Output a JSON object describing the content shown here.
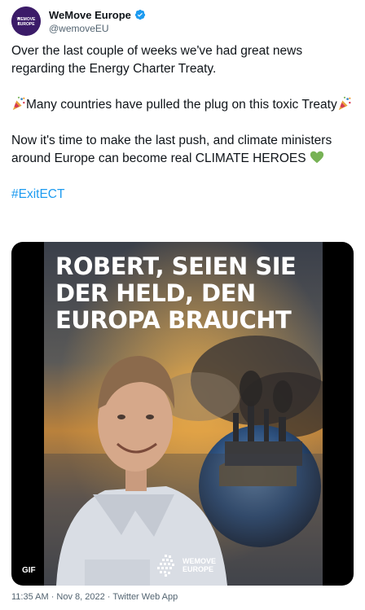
{
  "account": {
    "display_name": "WeMove Europe",
    "handle": "@wemoveEU",
    "avatar_text": "WEMOVE EUROPE"
  },
  "tweet": {
    "para1": "Over the last couple of weeks we've had great news regarding the Energy Charter Treaty.",
    "para2_main": "Many countries have pulled the plug on this toxic Treaty",
    "para3": "Now it's time to make the last push, and climate ministers around Europe can become real CLIMATE HEROES",
    "hashtag": "#ExitECT"
  },
  "media": {
    "headline_lines": [
      "ROBERT, SEIEN SIE",
      "DER HELD, DEN",
      "EUROPA BRAUCHT"
    ],
    "gif_badge": "GIF",
    "brand_line1": "WEMOVE",
    "brand_line2": "EUROPE"
  },
  "meta": {
    "timestamp": "11:35 AM · Nov 8, 2022 · Twitter Web App"
  },
  "colors": {
    "link": "#1d9bf0",
    "secondary_text": "#536471",
    "avatar_bg": "#3b1b68",
    "verified": "#1d9bf0"
  },
  "icons": {
    "verified": "verified-badge-icon",
    "party": "party-popper-emoji",
    "heart": "green-heart-emoji"
  }
}
